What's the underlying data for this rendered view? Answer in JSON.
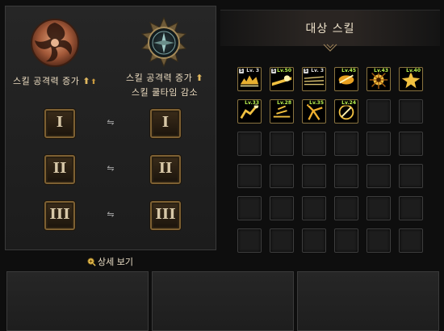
{
  "left": {
    "left_caption": "스킬 공격력 증가",
    "right_caption_line1": "스킬 공격력 증가",
    "right_caption_line2": "스킬 쿨타임 감소",
    "tiers": [
      "I",
      "II",
      "III"
    ],
    "detail_link": "상세 보기"
  },
  "right": {
    "header_title": "대상 스킬",
    "skills": [
      {
        "badge": "S",
        "level": "Lv. 3",
        "level_color": "grey"
      },
      {
        "badge": "S",
        "level": "Lv.50",
        "level_color": "green"
      },
      {
        "badge": "S",
        "level": "Lv. 3",
        "level_color": "grey"
      },
      {
        "badge": "",
        "level": "Lv.45",
        "level_color": "green"
      },
      {
        "badge": "",
        "level": "Lv.43",
        "level_color": "green"
      },
      {
        "badge": "",
        "level": "Lv.40",
        "level_color": "green"
      },
      {
        "badge": "",
        "level": "Lv.33",
        "level_color": "green"
      },
      {
        "badge": "",
        "level": "Lv.28",
        "level_color": "green"
      },
      {
        "badge": "",
        "level": "Lv.35",
        "level_color": "green"
      },
      {
        "badge": "",
        "level": "Lv.24",
        "level_color": "green"
      }
    ],
    "grid_rows": 6,
    "grid_cols": 6
  },
  "colors": {
    "accent_gold": "#c99a40",
    "level_green": "#b8f050"
  },
  "icons": [
    "swirl-emblem-icon",
    "compass-emblem-icon",
    "swap-arrows-icon",
    "magnifier-plus-icon",
    "up-arrow-icon"
  ]
}
